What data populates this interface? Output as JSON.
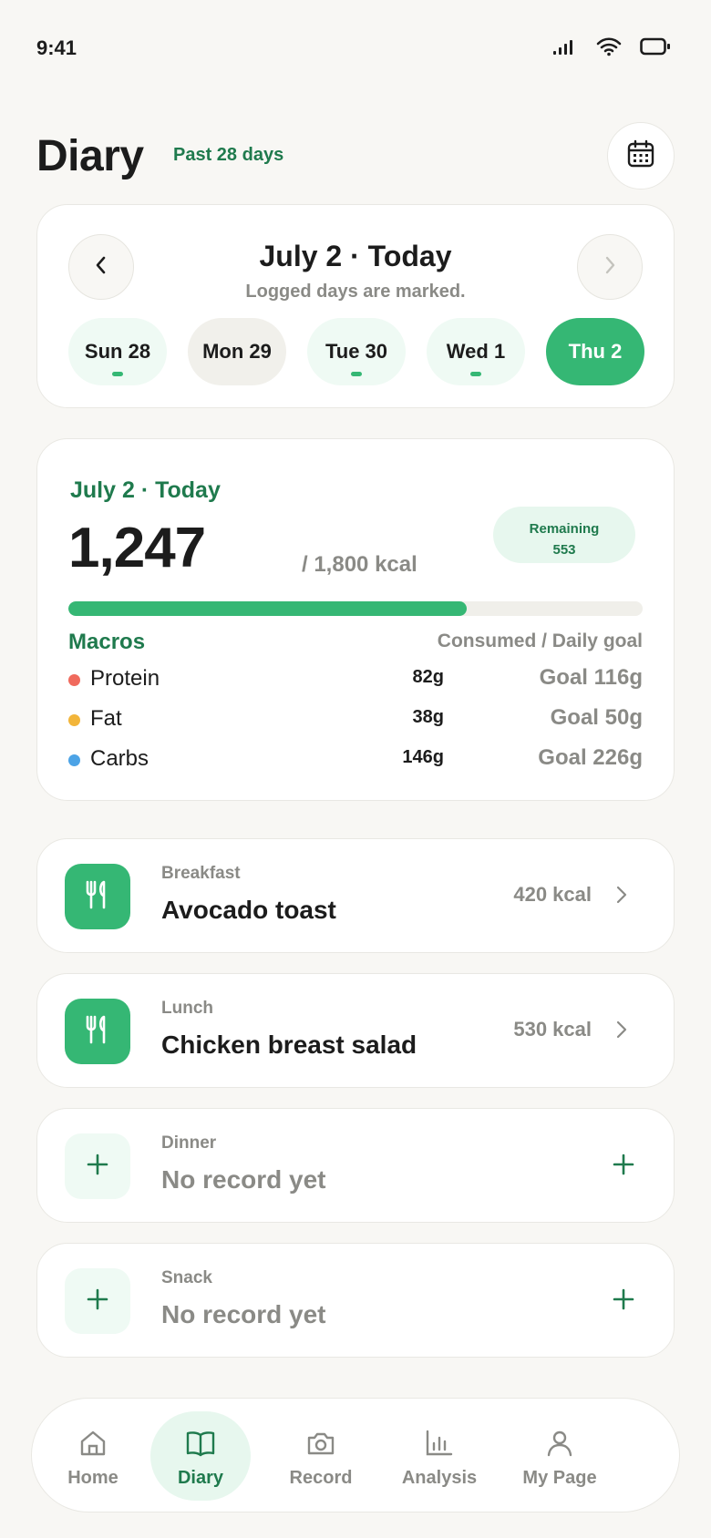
{
  "status_bar": {
    "time": "9:41"
  },
  "header": {
    "title": "Diary",
    "subtitle": "Past 28 days"
  },
  "date_picker": {
    "title": "July 2 · Today",
    "hint": "Logged days are marked.",
    "days": [
      {
        "label": "Sun 28",
        "state": "logged"
      },
      {
        "label": "Mon 29",
        "state": "not-logged"
      },
      {
        "label": "Tue 30",
        "state": "logged"
      },
      {
        "label": "Wed 1",
        "state": "logged"
      },
      {
        "label": "Thu 2",
        "state": "selected"
      }
    ]
  },
  "summary": {
    "date_label": "July 2 · Today",
    "consumed": "1,247",
    "goal": "/ 1,800 kcal",
    "remaining_label": "Remaining",
    "remaining_value": "553",
    "progress_fraction": 0.693,
    "macros_title": "Macros",
    "macros_legend": "Consumed / Daily goal",
    "macros": [
      {
        "name": "Protein",
        "consumed": "82g",
        "goal": "Goal 116g",
        "color": "#f06a5d"
      },
      {
        "name": "Fat",
        "consumed": "38g",
        "goal": "Goal 50g",
        "color": "#f2b53a"
      },
      {
        "name": "Carbs",
        "consumed": "146g",
        "goal": "Goal 226g",
        "color": "#4ca3e6"
      }
    ]
  },
  "meals": [
    {
      "type": "Breakfast",
      "name": "Avocado toast",
      "kcal": "420 kcal",
      "logged": true
    },
    {
      "type": "Lunch",
      "name": "Chicken breast salad",
      "kcal": "530 kcal",
      "logged": true
    },
    {
      "type": "Dinner",
      "name": "No record yet",
      "kcal": "",
      "logged": false
    },
    {
      "type": "Snack",
      "name": "No record yet",
      "kcal": "",
      "logged": false
    }
  ],
  "nav": [
    {
      "label": "Home",
      "icon": "home-icon",
      "active": false
    },
    {
      "label": "Diary",
      "icon": "book-icon",
      "active": true
    },
    {
      "label": "Record",
      "icon": "camera-icon",
      "active": false
    },
    {
      "label": "Analysis",
      "icon": "chart-icon",
      "active": false
    },
    {
      "label": "My Page",
      "icon": "user-icon",
      "active": false
    }
  ],
  "colors": {
    "accent": "#35b774",
    "accent_dark": "#1f7a4d",
    "accent_soft": "#e7f7ee",
    "muted_text": "#8a8a86",
    "background": "#f8f7f4"
  }
}
